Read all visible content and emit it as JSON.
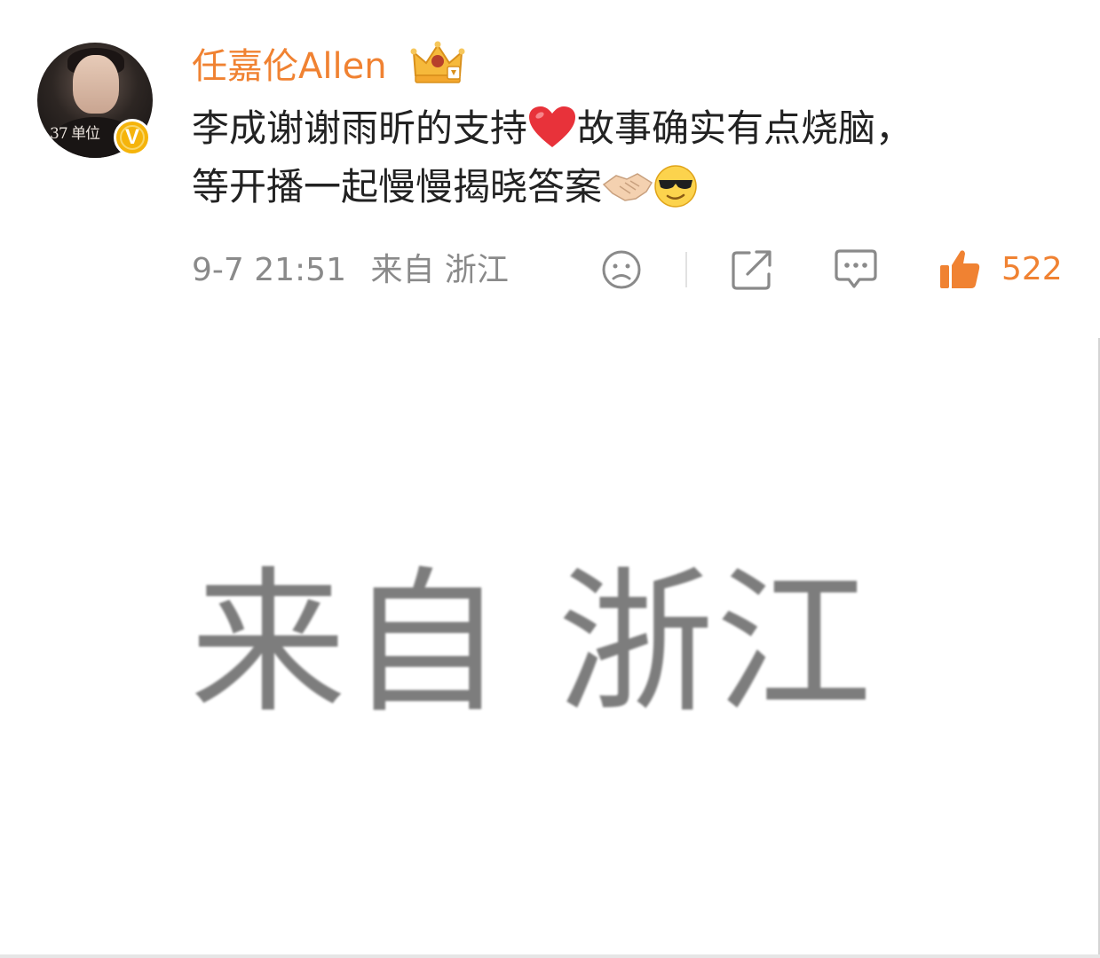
{
  "post": {
    "username": "任嘉伦Allen",
    "avatar_caption": "37 单位",
    "verified_badge": "V",
    "content_line1": "李成谢谢雨昕的支持",
    "content_line1_b": "故事确实有点烧脑，",
    "content_line2": "等开播一起慢慢揭晓答案",
    "emojis": [
      "red-heart",
      "handshake",
      "sunglasses-face"
    ],
    "timestamp": "9-7 21:51",
    "location_label": "来自 浙江",
    "like_count": "522",
    "accent_color": "#f08232",
    "icons": [
      "sad-face-icon",
      "share-icon",
      "comment-icon",
      "thumbs-up-icon"
    ]
  },
  "zoom": {
    "location_large": "来自 浙江"
  }
}
